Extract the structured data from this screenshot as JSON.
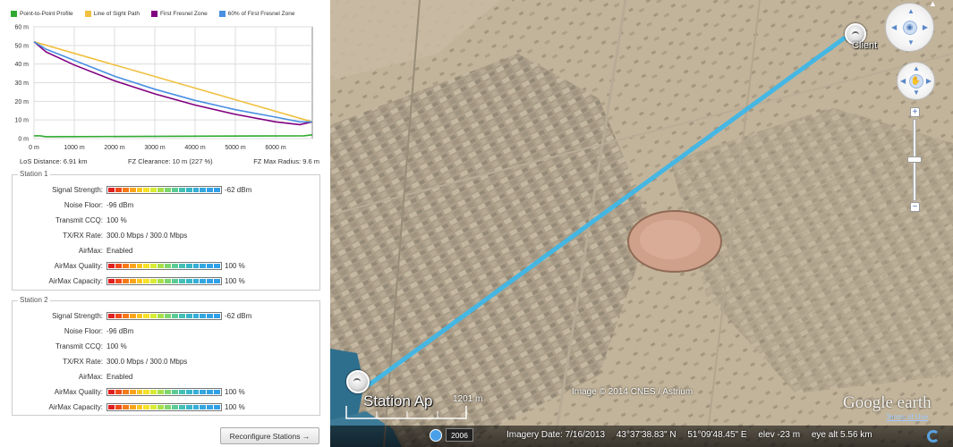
{
  "legend": [
    {
      "label": "Point-to-Point Profile",
      "color": "#2faa2f"
    },
    {
      "label": "Line of Sight Path",
      "color": "#f0c040"
    },
    {
      "label": "First Fresnel Zone",
      "color": "#800080"
    },
    {
      "label": "60% of First Fresnel Zone",
      "color": "#4a90e2"
    }
  ],
  "chart_data": {
    "type": "line",
    "xlim": [
      0,
      6910
    ],
    "ylim": [
      0,
      60
    ],
    "x_ticks": [
      0,
      1000,
      2000,
      3000,
      4000,
      5000,
      6000
    ],
    "x_tick_labels": [
      "0 m",
      "1000 m",
      "2000 m",
      "3000 m",
      "4000 m",
      "5000 m",
      "6000 m"
    ],
    "y_ticks": [
      0,
      10,
      20,
      30,
      40,
      50,
      60
    ],
    "y_tick_labels": [
      "0 m",
      "10 m",
      "20 m",
      "30 m",
      "40 m",
      "50 m",
      "60 m"
    ],
    "grid": true,
    "series": [
      {
        "name": "Point-to-Point Profile",
        "color": "#2faa2f",
        "x": [
          0,
          150,
          300,
          6700,
          6910
        ],
        "y": [
          1.5,
          1.5,
          1,
          1.5,
          2
        ]
      },
      {
        "name": "Line of Sight Path",
        "color": "#f0c040",
        "x": [
          0,
          6910
        ],
        "y": [
          52,
          9
        ]
      },
      {
        "name": "First Fresnel Zone",
        "color": "#800080",
        "x": [
          0,
          300,
          1000,
          2000,
          3000,
          4000,
          5000,
          6000,
          6600,
          6910
        ],
        "y": [
          52,
          46.5,
          39.5,
          31,
          24,
          18,
          13,
          9,
          7.5,
          9
        ]
      },
      {
        "name": "60% of First Fresnel Zone",
        "color": "#4a90e2",
        "x": [
          0,
          300,
          1000,
          2000,
          3000,
          4000,
          5000,
          6000,
          6600,
          6910
        ],
        "y": [
          52,
          48,
          42,
          33.5,
          26.5,
          20.5,
          15.5,
          11.5,
          9,
          9
        ]
      }
    ]
  },
  "stats": {
    "los_distance": "LoS Distance: 6.91 km",
    "fz_clearance": "FZ Clearance: 10 m  (227 %)",
    "fz_max_radius": "FZ Max Radius: 9.6 m"
  },
  "station1": {
    "title": "Station 1",
    "signal_strength_label": "Signal Strength:",
    "signal_strength_value": "-62 dBm",
    "noise_floor_label": "Noise Floor:",
    "noise_floor_value": "-96 dBm",
    "transmit_ccq_label": "Transmit CCQ:",
    "transmit_ccq_value": "100 %",
    "txrx_label": "TX/RX Rate:",
    "txrx_value": "300.0 Mbps / 300.0 Mbps",
    "airmax_label": "AirMax:",
    "airmax_value": "Enabled",
    "airmax_quality_label": "AirMax Quality:",
    "airmax_quality_value": "100 %",
    "airmax_capacity_label": "AirMax Capacity:",
    "airmax_capacity_value": "100 %"
  },
  "station2": {
    "title": "Station 2",
    "signal_strength_label": "Signal Strength:",
    "signal_strength_value": "-62 dBm",
    "noise_floor_label": "Noise Floor:",
    "noise_floor_value": "-96 dBm",
    "transmit_ccq_label": "Transmit CCQ:",
    "transmit_ccq_value": "100 %",
    "txrx_label": "TX/RX Rate:",
    "txrx_value": "300.0 Mbps / 300.0 Mbps",
    "airmax_label": "AirMax:",
    "airmax_value": "Enabled",
    "airmax_quality_label": "AirMax Quality:",
    "airmax_quality_value": "100 %",
    "airmax_capacity_label": "AirMax Capacity:",
    "airmax_capacity_value": "100 %"
  },
  "signal_bar_colors": [
    "#e02020",
    "#f04a1a",
    "#f57a18",
    "#f9a41b",
    "#fbc723",
    "#f6e22a",
    "#d9ec35",
    "#a8e04b",
    "#7fd56e",
    "#5ccb95",
    "#44c0b5",
    "#3ab6c9",
    "#36aed6",
    "#34a7df",
    "#33a2e4",
    "#32a0e8"
  ],
  "reconfigure_label": "Reconfigure Stations →",
  "map": {
    "client_label": "Client",
    "station_ap_label": "Station Ap",
    "scale_label": "1201 m",
    "copyright": "Image © 2014 CNES / Astrium",
    "google_logo": "Google earth",
    "terms": "Terms of Use",
    "year": "2006",
    "imagery_date": "Imagery Date: 7/16/2013",
    "lat": "43°37'38.83\" N",
    "lon": "51°09'48.45\" E",
    "elev": "elev  -23 m",
    "eye_alt": "eye alt   5.56 km",
    "link_color": "#3fb8e8"
  }
}
